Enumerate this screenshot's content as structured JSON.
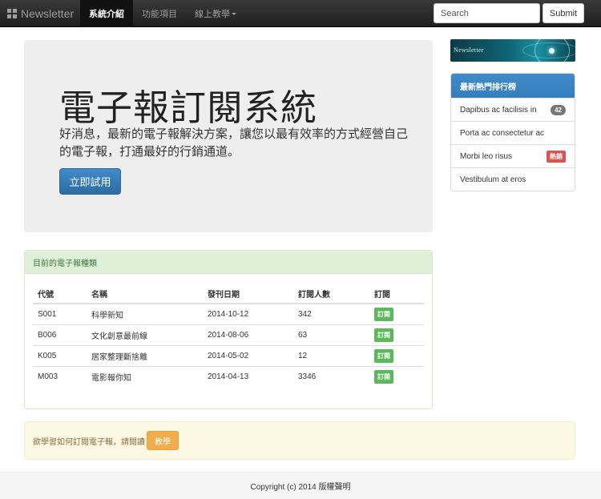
{
  "navbar": {
    "brand": "Newsletter",
    "items": [
      {
        "label": "系統介紹",
        "active": true
      },
      {
        "label": "功能項目",
        "active": false
      },
      {
        "label": "線上教學",
        "active": false,
        "dropdown": true
      }
    ],
    "search_placeholder": "Search",
    "submit_label": "Submit"
  },
  "jumbotron": {
    "title": "電子報訂閱系統",
    "lead": "好消息，最新的電子報解決方案，讓您以最有效率的方式經營自己的電子報，打通最好的行銷通道。",
    "button_label": "立即試用"
  },
  "newsletter_panel": {
    "heading": "目前的電子報種類",
    "columns": [
      "代號",
      "名稱",
      "發刊日期",
      "訂閱人數",
      "訂閱"
    ],
    "rows": [
      {
        "code": "S001",
        "name": "科學新知",
        "date": "2014-10-12",
        "count": "342",
        "action": "訂閱"
      },
      {
        "code": "B006",
        "name": "文化創意最前線",
        "date": "2014-08-06",
        "count": "63",
        "action": "訂閱"
      },
      {
        "code": "K005",
        "name": "居家整理斷捨離",
        "date": "2014-05-02",
        "count": "12",
        "action": "訂閱"
      },
      {
        "code": "M003",
        "name": "電影報你知",
        "date": "2014-04-13",
        "count": "3346",
        "action": "訂閱"
      }
    ]
  },
  "sidebar": {
    "banner_text": "Newsletter",
    "ranking_heading": "最新熱門排行榜",
    "items": [
      {
        "label": "Dapibus ac facilisis in",
        "badge": "42"
      },
      {
        "label": "Porta ac consectetur ac"
      },
      {
        "label": "Morbi leo risus",
        "tag": "熱銷"
      },
      {
        "label": "Vestibulum at eros"
      }
    ]
  },
  "notice": {
    "text": "欲學習如何訂閱電子報，請閱讀",
    "button_label": "教學"
  },
  "footer": {
    "text": "Copyright (c) 2014 版權聲明"
  },
  "colors": {
    "primary": "#428bca",
    "success": "#5cb85c",
    "warning": "#f0ad4e",
    "danger": "#d9534f"
  }
}
